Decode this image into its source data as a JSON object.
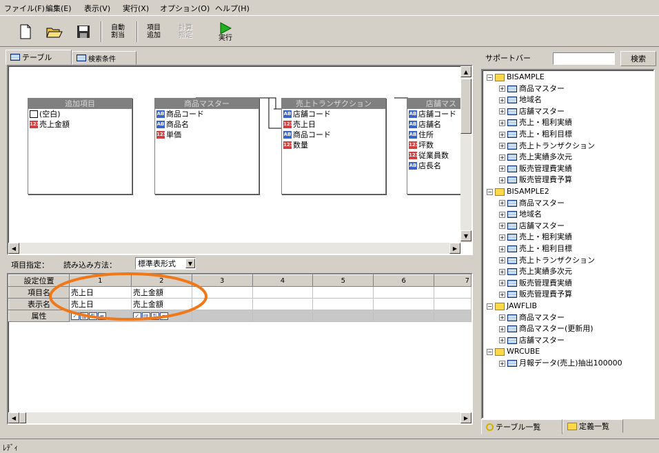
{
  "menu": [
    "ファイル(F)",
    "編集(E)",
    "表示(V)",
    "実行(X)",
    "オプション(O)",
    "ヘルプ(H)"
  ],
  "toolbar": {
    "auto_assign": [
      "自動",
      "割当"
    ],
    "add_item": [
      "項目",
      "追加"
    ],
    "calc_spec": [
      "計算",
      "指定"
    ],
    "run": "実行"
  },
  "left_tabs": [
    "テーブル",
    "検索条件"
  ],
  "tables": [
    {
      "title": "追加項目",
      "fields": [
        {
          "icon": "doc",
          "name": "(空白)"
        },
        {
          "icon": "num",
          "name": "売上金額"
        }
      ]
    },
    {
      "title": "商品マスター",
      "fields": [
        {
          "icon": "ab",
          "name": "商品コード"
        },
        {
          "icon": "ab",
          "name": "商品名"
        },
        {
          "icon": "num",
          "name": "単価"
        }
      ]
    },
    {
      "title": "売上トランザクション",
      "fields": [
        {
          "icon": "ab",
          "name": "店舗コード"
        },
        {
          "icon": "num",
          "name": "売上日"
        },
        {
          "icon": "ab",
          "name": "商品コード"
        },
        {
          "icon": "num",
          "name": "数量"
        }
      ]
    },
    {
      "title": "店舗マス",
      "fields": [
        {
          "icon": "ab",
          "name": "店舗コード"
        },
        {
          "icon": "ab",
          "name": "店舗名"
        },
        {
          "icon": "ab",
          "name": "住所"
        },
        {
          "icon": "num",
          "name": "坪数"
        },
        {
          "icon": "num",
          "name": "従業員数"
        },
        {
          "icon": "ab",
          "name": "店長名"
        }
      ]
    }
  ],
  "props": {
    "item_spec_label": "項目指定：",
    "read_method_label": "読み込み方法：",
    "read_method_value": "標準表形式"
  },
  "grid": {
    "columns": [
      "設定位置",
      "1",
      "2",
      "3",
      "4",
      "5",
      "6",
      "7"
    ],
    "rows": [
      {
        "label": "項目名",
        "cells": [
          "売上日",
          "売上金額",
          "",
          "",
          "",
          "",
          ""
        ]
      },
      {
        "label": "表示名",
        "cells": [
          "売上日",
          "売上金額",
          "",
          "",
          "",
          "",
          ""
        ]
      },
      {
        "label": "属性",
        "cells": [
          "",
          "",
          "",
          "",
          "",
          "",
          ""
        ]
      }
    ]
  },
  "support_bar": {
    "label": "サポートバー",
    "search_value": "",
    "search_button": "検索"
  },
  "tree": [
    {
      "level": 0,
      "kind": "folder",
      "label": "BISAMPLE"
    },
    {
      "level": 1,
      "kind": "table",
      "label": "商品マスター"
    },
    {
      "level": 1,
      "kind": "table",
      "label": "地域名"
    },
    {
      "level": 1,
      "kind": "table",
      "label": "店舗マスター"
    },
    {
      "level": 1,
      "kind": "table",
      "label": "売上・粗利実績"
    },
    {
      "level": 1,
      "kind": "table",
      "label": "売上・粗利目標"
    },
    {
      "level": 1,
      "kind": "table",
      "label": "売上トランザクション"
    },
    {
      "level": 1,
      "kind": "table",
      "label": "売上実績多次元"
    },
    {
      "level": 1,
      "kind": "table",
      "label": "販売管理費実績"
    },
    {
      "level": 1,
      "kind": "table",
      "label": "販売管理費予算"
    },
    {
      "level": 0,
      "kind": "folder",
      "label": "BISAMPLE2"
    },
    {
      "level": 1,
      "kind": "table",
      "label": "商品マスター"
    },
    {
      "level": 1,
      "kind": "table",
      "label": "地域名"
    },
    {
      "level": 1,
      "kind": "table",
      "label": "店舗マスター"
    },
    {
      "level": 1,
      "kind": "table",
      "label": "売上・粗利実績"
    },
    {
      "level": 1,
      "kind": "table",
      "label": "売上・粗利目標"
    },
    {
      "level": 1,
      "kind": "table",
      "label": "売上トランザクション"
    },
    {
      "level": 1,
      "kind": "table",
      "label": "売上実績多次元"
    },
    {
      "level": 1,
      "kind": "table",
      "label": "販売管理費実績"
    },
    {
      "level": 1,
      "kind": "table",
      "label": "販売管理費予算"
    },
    {
      "level": 0,
      "kind": "folder",
      "label": "JAWFLIB"
    },
    {
      "level": 1,
      "kind": "table",
      "label": "商品マスター"
    },
    {
      "level": 1,
      "kind": "table",
      "label": "商品マスター(更新用)"
    },
    {
      "level": 1,
      "kind": "table",
      "label": "店舗マスター"
    },
    {
      "level": 0,
      "kind": "folder",
      "label": "WRCUBE"
    },
    {
      "level": 1,
      "kind": "table",
      "label": "月報データ(売上)抽出100000"
    }
  ],
  "right_tabs": [
    "テーブル一覧",
    "定義一覧"
  ],
  "status_text": "ﾚﾃﾞｨ",
  "colors": {
    "highlight_ellipse": "#f07818",
    "run_icon": "#20b020"
  }
}
